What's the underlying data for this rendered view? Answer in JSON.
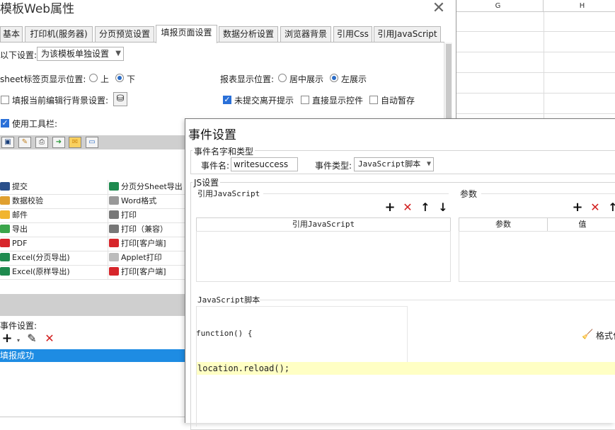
{
  "spreadsheet": {
    "columns": [
      "G",
      "H"
    ]
  },
  "dialog": {
    "title": "模板Web属性",
    "close_glyph": "✕",
    "tabs": [
      "基本",
      "打印机(服务器)",
      "分页预览设置",
      "填报页面设置",
      "数据分析设置",
      "浏览器背景",
      "引用Css",
      "引用JavaScript"
    ],
    "active_tab": "填报页面设置",
    "settings_label": "以下设置:",
    "settings_select": "为该模板单独设置",
    "sheet_tab_label": "sheet标签页显示位置:",
    "sheet_tab_options": [
      "上",
      "下"
    ],
    "sheet_tab_selected": "下",
    "report_pos_label": "报表显示位置:",
    "report_pos_options": [
      "居中展示",
      "左展示"
    ],
    "report_pos_selected": "左展示",
    "fill_bg_label": "填报当前编辑行背景设置:",
    "unsubmitted_label": "未提交离开提示",
    "unsubmitted_checked": true,
    "show_controls_label": "直接显示控件",
    "show_controls_checked": false,
    "auto_save_label": "自动暂存",
    "auto_save_checked": false,
    "use_toolbar_label": "使用工具栏:",
    "use_toolbar_checked": true,
    "toolbar_icons": [
      "save-icon",
      "pencil-icon",
      "print-icon",
      "export-icon",
      "mail-icon",
      "window-icon"
    ],
    "items_left": [
      "提交",
      "数据校验",
      "邮件",
      "导出",
      "PDF",
      "Excel(分页导出)",
      "Excel(原样导出)"
    ],
    "items_right": [
      "分页分Sheet导出",
      "Word格式",
      "打印",
      "打印（兼容）",
      "打印[客户端]",
      "Applet打印",
      "打印[客户端]"
    ],
    "event_settings_label": "事件设置:",
    "event_row": "填报成功"
  },
  "event_dialog": {
    "title": "事件设置",
    "group_name_type": "事件名字和类型",
    "event_name_label": "事件名:",
    "event_name_value": "writesuccess",
    "event_type_label": "事件类型:",
    "event_type_value": "JavaScript脚本",
    "js_settings_label": "JS设置",
    "ref_js_label": "引用JavaScript",
    "ref_js_header": "引用JavaScript",
    "params_label": "参数",
    "params_header_param": "参数",
    "params_header_value": "值",
    "script_label": "JavaScript脚本",
    "function_text": "function() {",
    "format_label": "格式化",
    "code_line": "location.reload();"
  }
}
